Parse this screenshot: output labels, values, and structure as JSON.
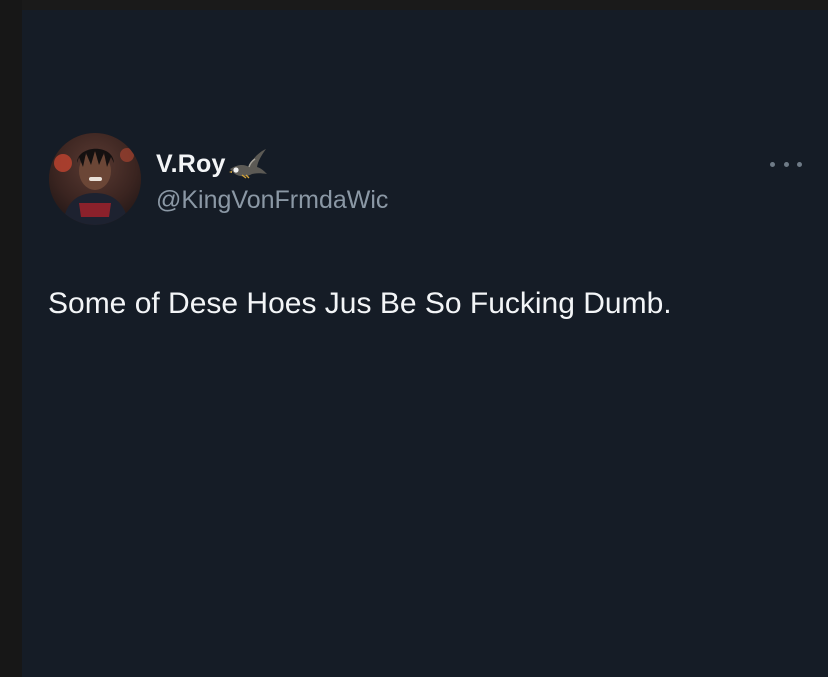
{
  "tweet": {
    "display_name": "V.Roy",
    "handle": "@KingVonFrmdaWic",
    "text": "Some of Dese Hoes Jus Be So Fucking Dumb.",
    "name_icon": "eagle-icon",
    "more_icon": "more-options-icon"
  },
  "colors": {
    "background": "#151c26",
    "primary_text": "#f3f5f7",
    "secondary_text": "#8b98a5"
  }
}
